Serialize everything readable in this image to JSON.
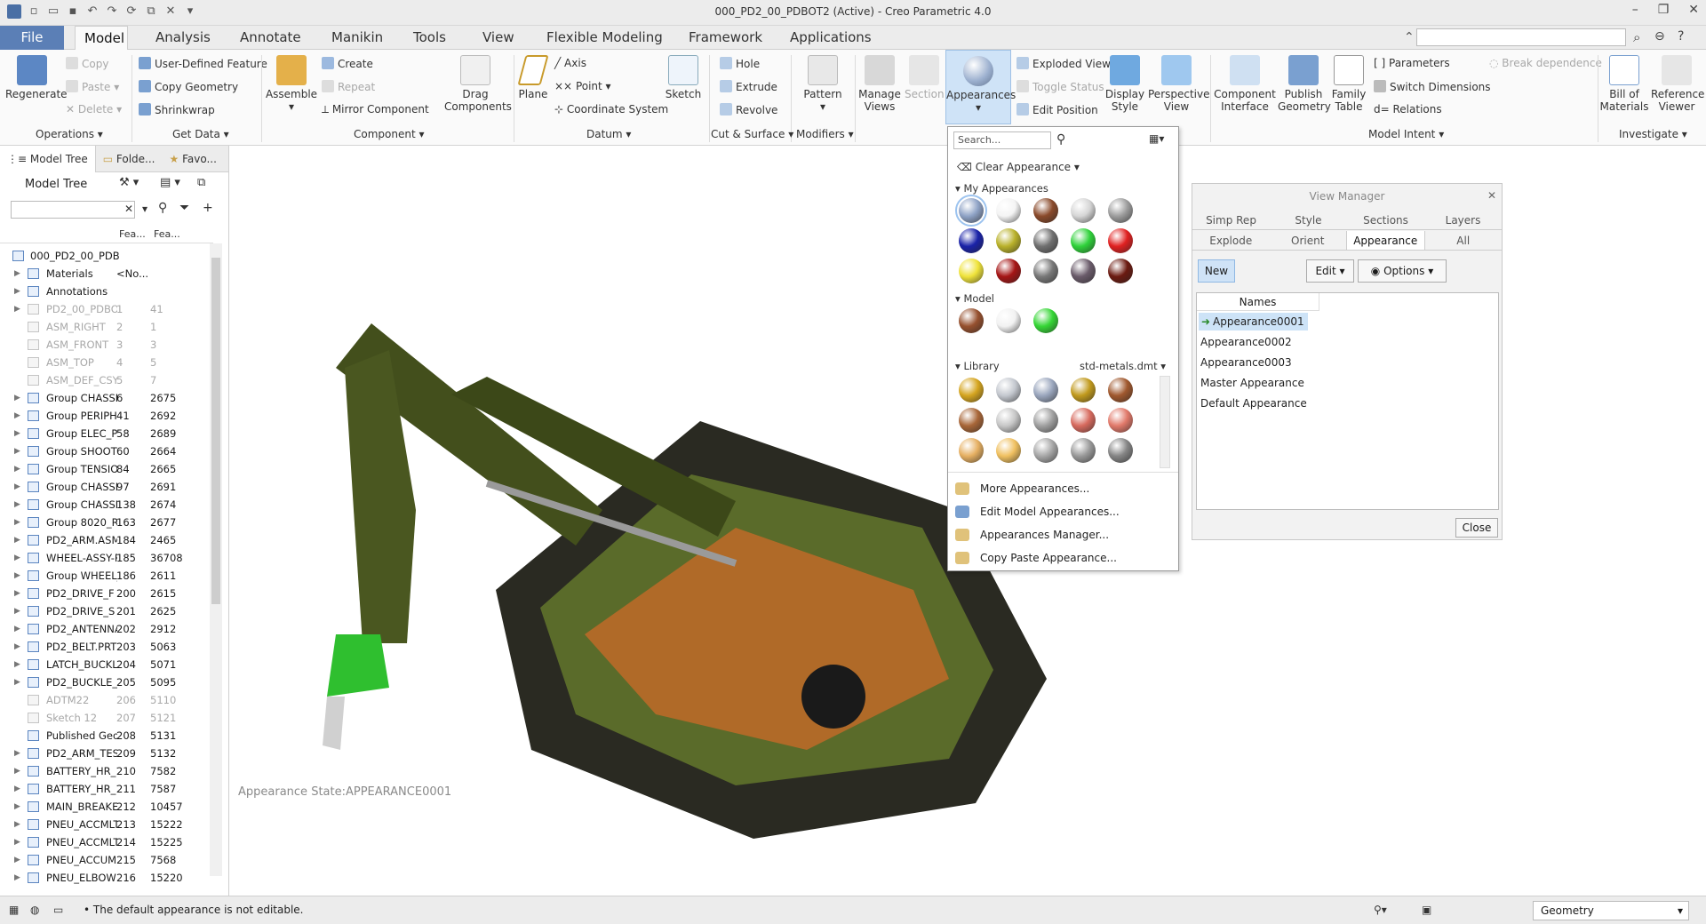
{
  "window": {
    "title": "000_PD2_00_PDBOT2 (Active) - Creo Parametric 4.0"
  },
  "menu": {
    "tabs": [
      "File",
      "Model",
      "Analysis",
      "Annotate",
      "Manikin",
      "Tools",
      "View",
      "Flexible Modeling",
      "Framework",
      "Applications"
    ],
    "active": "Model"
  },
  "ribbon": {
    "regenerate": "Regenerate",
    "copy": "Copy",
    "paste": "Paste",
    "delete": "Delete",
    "udf": "User-Defined Feature",
    "copy_geometry": "Copy Geometry",
    "shrinkwrap": "Shrinkwrap",
    "assemble": "Assemble",
    "create": "Create",
    "repeat": "Repeat",
    "mirror_component": "Mirror Component",
    "drag_components": "Drag Components",
    "plane": "Plane",
    "axis": "Axis",
    "point": "Point",
    "coordinate_system": "Coordinate System",
    "sketch": "Sketch",
    "hole": "Hole",
    "extrude": "Extrude",
    "revolve": "Revolve",
    "pattern": "Pattern",
    "manage_views": "Manage Views",
    "section": "Section",
    "appearances": "Appearances",
    "exploded_view": "Exploded View",
    "toggle_status": "Toggle Status",
    "edit_position": "Edit Position",
    "display_style": "Display Style",
    "perspective_view": "Perspective View",
    "component_interface": "Component Interface",
    "publish_geometry": "Publish Geometry",
    "family_table": "Family Table",
    "parameters": "Parameters",
    "switch_dimensions": "Switch Dimensions",
    "relations": "Relations",
    "break_dependence": "Break dependence",
    "bill_of_materials": "Bill of Materials",
    "reference_viewer": "Reference Viewer",
    "groups": [
      "Operations",
      "Get Data",
      "Component",
      "Datum",
      "Cut & Surface",
      "Modifiers",
      "Model Intent",
      "Investigate"
    ]
  },
  "panel": {
    "tabs": [
      "Model Tree",
      "Folde...",
      "Favo..."
    ],
    "tree_title": "Model Tree",
    "col1": "Fea...",
    "col2": "Fea...",
    "rows": [
      {
        "name": "000_PD2_00_PDBO",
        "c1": "",
        "c2": ""
      },
      {
        "name": "Materials",
        "c1": "<No...",
        "c2": ""
      },
      {
        "name": "Annotations",
        "c1": "",
        "c2": ""
      },
      {
        "name": "PD2_00_PDBOT",
        "c1": "1",
        "c2": "41"
      },
      {
        "name": "ASM_RIGHT",
        "c1": "2",
        "c2": "1"
      },
      {
        "name": "ASM_FRONT",
        "c1": "3",
        "c2": "3"
      },
      {
        "name": "ASM_TOP",
        "c1": "4",
        "c2": "5"
      },
      {
        "name": "ASM_DEF_CSYS",
        "c1": "5",
        "c2": "7"
      },
      {
        "name": "Group CHASSI",
        "c1": "6",
        "c2": "2675"
      },
      {
        "name": "Group PERIPH",
        "c1": "41",
        "c2": "2692"
      },
      {
        "name": "Group ELEC_P",
        "c1": "58",
        "c2": "2689"
      },
      {
        "name": "Group SHOOTI",
        "c1": "60",
        "c2": "2664"
      },
      {
        "name": "Group TENSIO",
        "c1": "84",
        "c2": "2665"
      },
      {
        "name": "Group CHASSI",
        "c1": "97",
        "c2": "2691"
      },
      {
        "name": "Group CHASSI",
        "c1": "138",
        "c2": "2674"
      },
      {
        "name": "Group 8020_R",
        "c1": "163",
        "c2": "2677"
      },
      {
        "name": "PD2_ARM.ASM",
        "c1": "184",
        "c2": "2465"
      },
      {
        "name": "WHEEL-ASSY-P",
        "c1": "185",
        "c2": "36708"
      },
      {
        "name": "Group WHEEL_",
        "c1": "186",
        "c2": "2611"
      },
      {
        "name": "PD2_DRIVE_F",
        "c1": "200",
        "c2": "2615"
      },
      {
        "name": "PD2_DRIVE_S",
        "c1": "201",
        "c2": "2625"
      },
      {
        "name": "PD2_ANTENNA",
        "c1": "202",
        "c2": "2912"
      },
      {
        "name": "PD2_BELT.PRT",
        "c1": "203",
        "c2": "5063"
      },
      {
        "name": "LATCH_BUCKLE",
        "c1": "204",
        "c2": "5071"
      },
      {
        "name": "PD2_BUCKLE_N",
        "c1": "205",
        "c2": "5095"
      },
      {
        "name": "ADTM22",
        "c1": "206",
        "c2": "5110"
      },
      {
        "name": "Sketch 12",
        "c1": "207",
        "c2": "5121"
      },
      {
        "name": "Published Geo",
        "c1": "208",
        "c2": "5131"
      },
      {
        "name": "PD2_ARM_TEST",
        "c1": "209",
        "c2": "5132"
      },
      {
        "name": "BATTERY_HR_1",
        "c1": "210",
        "c2": "7582"
      },
      {
        "name": "BATTERY_HR_1",
        "c1": "211",
        "c2": "7587"
      },
      {
        "name": "MAIN_BREAKEI",
        "c1": "212",
        "c2": "10457"
      },
      {
        "name": "PNEU_ACCMLT",
        "c1": "213",
        "c2": "15222"
      },
      {
        "name": "PNEU_ACCMLT",
        "c1": "214",
        "c2": "15225"
      },
      {
        "name": "PNEU_ACCUMI",
        "c1": "215",
        "c2": "7568"
      },
      {
        "name": "PNEU_ELBOW",
        "c1": "216",
        "c2": "15220"
      }
    ]
  },
  "viewport": {
    "appearance_state": "Appearance State:APPEARANCE0001"
  },
  "dropdown": {
    "search_placeholder": "Search...",
    "clear": "Clear Appearance",
    "my": "My Appearances",
    "model": "Model",
    "library": "Library",
    "library_file": "std-metals.dmt",
    "my_colors": [
      "#8fa3c6",
      "#f4f4f4",
      "#8a4a2b",
      "#d6d6d6",
      "#9d9d9d",
      "#1a22a8",
      "#b9b12a",
      "#707070",
      "#2fd23a",
      "#e02020",
      "#efe33a",
      "#a51515",
      "#787878",
      "#6a5b6a",
      "#6b1a10"
    ],
    "model_colors": [
      "#96502e",
      "#f2f2f2",
      "#35d635"
    ],
    "library_colors": [
      "#d5a51f",
      "#c4c8cf",
      "#9aa6bd",
      "#c19a1d",
      "#a0582e",
      "#a86638",
      "#c7c7c7",
      "#a0a0a0",
      "#d76a5e",
      "#e1796a",
      "#e6b062",
      "#f0c060",
      "#a7a7a7",
      "#9a9a9a",
      "#858585"
    ],
    "more": "More Appearances...",
    "edit_model": "Edit Model Appearances...",
    "manager": "Appearances Manager...",
    "copy_paste": "Copy Paste Appearance..."
  },
  "view_manager": {
    "title": "View Manager",
    "tabs_row1": [
      "Simp Rep",
      "Style",
      "Sections",
      "Layers"
    ],
    "tabs_row2": [
      "Explode",
      "Orient",
      "Appearance",
      "All"
    ],
    "new": "New",
    "edit": "Edit",
    "options": "Options",
    "names_header": "Names",
    "items": [
      "Appearance0001",
      "Appearance0002",
      "Appearance0003",
      "Master Appearance",
      "Default Appearance"
    ],
    "close": "Close"
  },
  "status": {
    "message": "The default appearance is not editable.",
    "selection_filter": "Geometry"
  }
}
